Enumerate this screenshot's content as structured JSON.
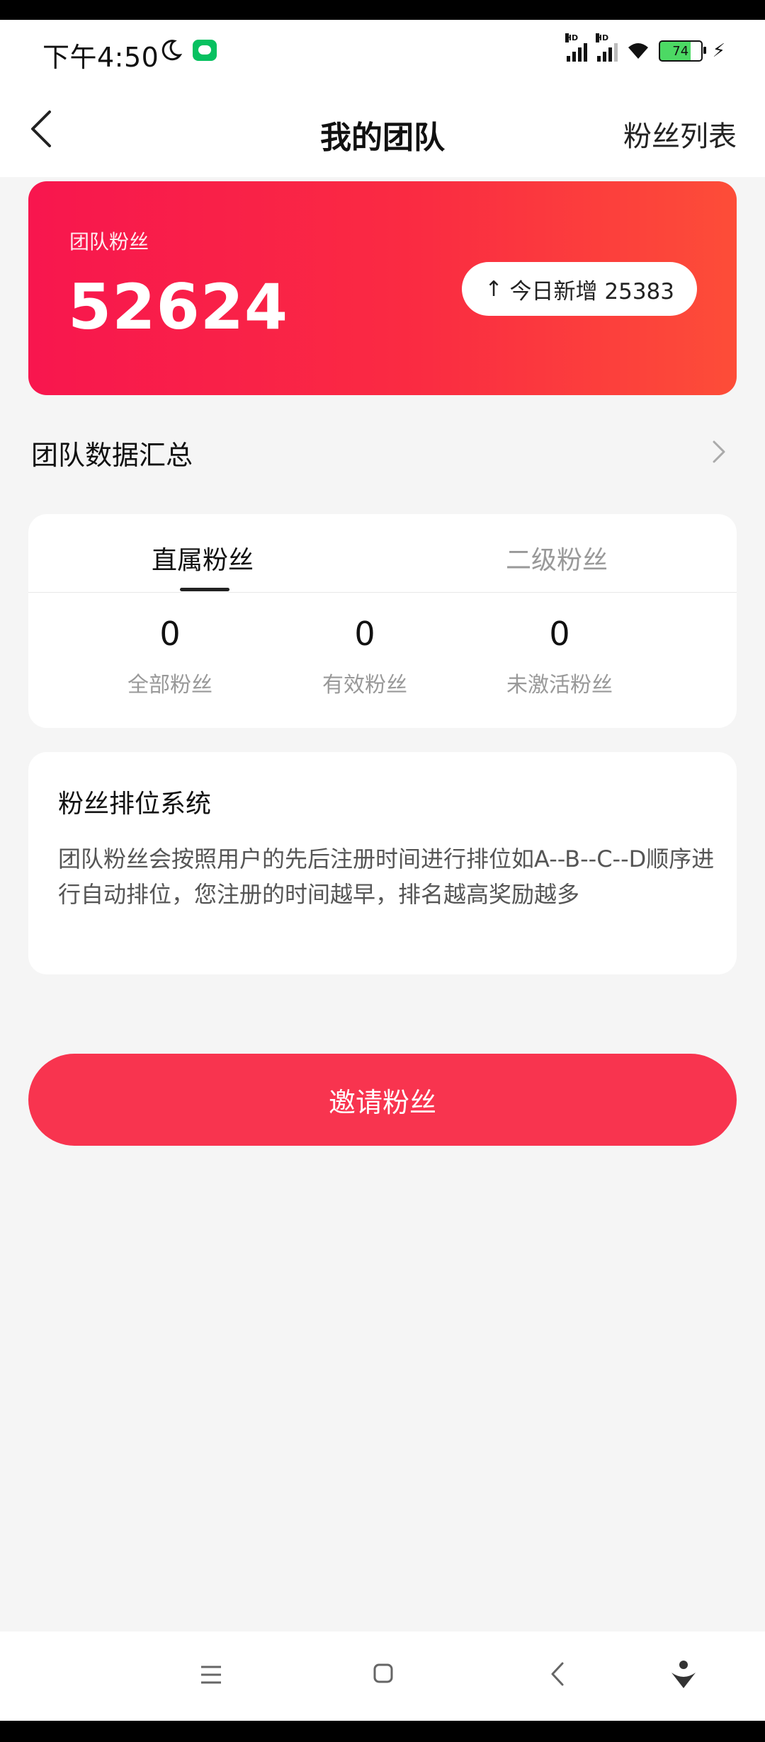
{
  "status_bar": {
    "time": "下午4:50",
    "signal_labels": [
      "HD",
      "HD"
    ],
    "battery_level": "74"
  },
  "header": {
    "title": "我的团队",
    "right_action": "粉丝列表"
  },
  "hero": {
    "label": "团队粉丝",
    "value": "52624",
    "badge_arrow": "↑",
    "badge_text": "今日新增 25383"
  },
  "summary": {
    "title": "团队数据汇总"
  },
  "stats": {
    "tabs": [
      {
        "label": "直属粉丝",
        "active": true
      },
      {
        "label": "二级粉丝",
        "active": false
      }
    ],
    "items": [
      {
        "value": "0",
        "label": "全部粉丝"
      },
      {
        "value": "0",
        "label": "有效粉丝"
      },
      {
        "value": "0",
        "label": "未激活粉丝"
      }
    ]
  },
  "ranking": {
    "title": "粉丝排位系统",
    "description": "团队粉丝会按照用户的先后注册时间进行排位如A--B--C--D顺序进行自动排位，您注册的时间越早，排名越高奖励越多"
  },
  "invite": {
    "label": "邀请粉丝"
  },
  "colors": {
    "accent": "#f8344f",
    "hero_start": "#f8164e",
    "hero_end": "#fd4d38",
    "background": "#f5f5f5"
  }
}
